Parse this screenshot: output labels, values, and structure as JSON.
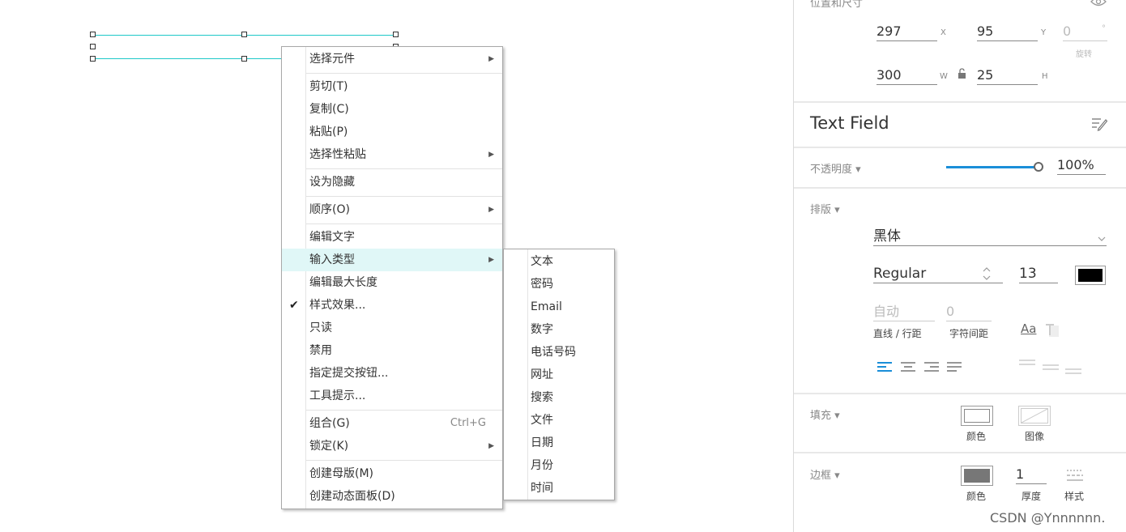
{
  "context_menu": {
    "items": [
      {
        "label": "选择元件",
        "submenu": true
      },
      {
        "label": "剪切(T)"
      },
      {
        "label": "复制(C)"
      },
      {
        "label": "粘贴(P)"
      },
      {
        "label": "选择性粘贴",
        "submenu": true
      },
      {
        "label": "设为隐藏"
      },
      {
        "label": "顺序(O)",
        "submenu": true
      },
      {
        "label": "编辑文字"
      },
      {
        "label": "输入类型",
        "submenu": true,
        "highlighted": true
      },
      {
        "label": "编辑最大长度"
      },
      {
        "label": "样式效果...",
        "checked": true
      },
      {
        "label": "只读"
      },
      {
        "label": "禁用"
      },
      {
        "label": "指定提交按钮..."
      },
      {
        "label": "工具提示..."
      },
      {
        "label": "组合(G)",
        "shortcut": "Ctrl+G"
      },
      {
        "label": "锁定(K)",
        "submenu": true
      },
      {
        "label": "创建母版(M)"
      },
      {
        "label": "创建动态面板(D)"
      }
    ],
    "arrow_glyph": "▶",
    "check_glyph": "✔"
  },
  "input_type_submenu": {
    "items": [
      "文本",
      "密码",
      "Email",
      "数字",
      "电话号码",
      "网址",
      "搜索",
      "文件",
      "日期",
      "月份",
      "时间"
    ]
  },
  "panel": {
    "section_position": "位置和尺寸",
    "x_value": "297",
    "x_label": "X",
    "y_value": "95",
    "y_label": "Y",
    "rotation_value": "0",
    "rotation_unit": "°",
    "rotation_label": "旋转",
    "w_value": "300",
    "w_label": "W",
    "h_value": "25",
    "h_label": "H",
    "widget_name": "Text Field",
    "opacity_label": "不透明度 ▾",
    "opacity_value": "100%",
    "opacity_level": 1.0,
    "typography_label": "排版 ▾",
    "font_family": "黑体",
    "font_style": "Regular",
    "font_size": "13",
    "font_color": "#000000",
    "line_height_value": "自动",
    "line_height_label": "直线 / 行距",
    "letter_spacing_value": "0",
    "letter_spacing_label": "字符间距",
    "aa_label": "Aa",
    "fill_label": "填充 ▾",
    "fill_color_label": "颜色",
    "fill_image_label": "图像",
    "border_label": "边框 ▾",
    "border_color": "#777777",
    "border_color_label": "颜色",
    "border_thickness_value": "1",
    "border_thickness_label": "厚度",
    "border_style_label": "样式",
    "accent_color": "#1a8ed8"
  },
  "watermark": "CSDN @Ynnnnnn."
}
